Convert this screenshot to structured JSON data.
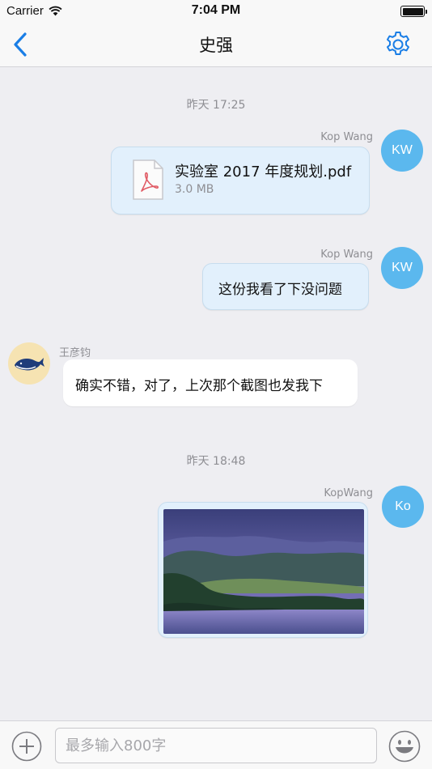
{
  "status_bar": {
    "carrier": "Carrier",
    "time": "7:04 PM"
  },
  "nav": {
    "title": "史强",
    "back_icon": "chevron-left-icon",
    "settings_icon": "gear-icon"
  },
  "accent_color": "#1a7ee6",
  "messages": [
    {
      "type": "timestamp",
      "text": "昨天 17:25"
    },
    {
      "type": "file",
      "direction": "out",
      "sender": "Kop Wang",
      "avatar": "KW",
      "file_name": "实验室 2017 年度规划.pdf",
      "file_size": "3.0 MB",
      "icon": "pdf-icon"
    },
    {
      "type": "text",
      "direction": "out",
      "sender": "Kop Wang",
      "avatar": "KW",
      "text": "这份我看了下没问题"
    },
    {
      "type": "text",
      "direction": "in",
      "sender": "王彦钧",
      "avatar_icon": "whale-icon",
      "text": "确实不错，对了，上次那个截图也发我下"
    },
    {
      "type": "timestamp",
      "text": "昨天 18:48"
    },
    {
      "type": "image",
      "direction": "out",
      "sender": "KopWang",
      "avatar": "Ko"
    }
  ],
  "input": {
    "placeholder": "最多输入800字",
    "value": "",
    "plus_icon": "plus-icon",
    "emoji_icon": "emoji-icon"
  }
}
